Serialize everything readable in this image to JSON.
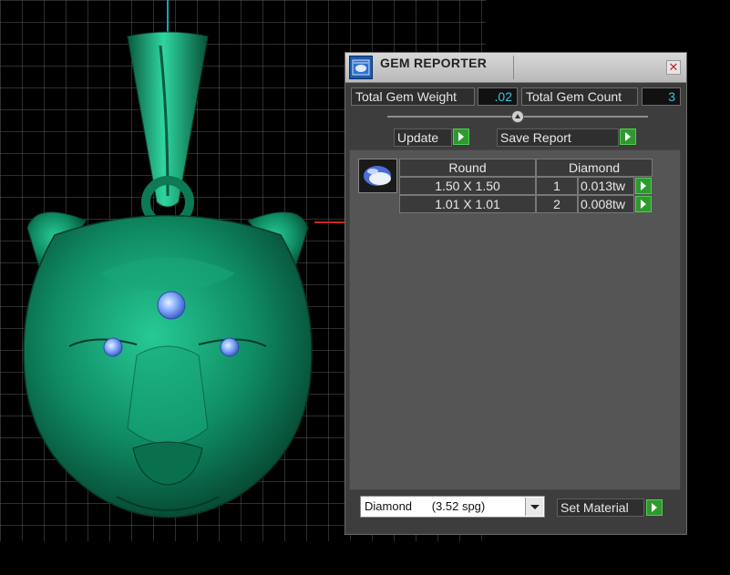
{
  "window": {
    "title": "GEM REPORTER",
    "close_glyph": "✕"
  },
  "summary": {
    "weight_label": "Total Gem Weight",
    "weight_value": ".02",
    "count_label": "Total Gem Count",
    "count_value": "3"
  },
  "slider": {
    "value_fraction": 0.5
  },
  "actions": {
    "update_label": "Update",
    "save_label": "Save Report"
  },
  "report": {
    "gem_icon": "gem-thumbnail-icon",
    "header": {
      "shape": "Round",
      "material": "Diamond"
    },
    "rows": [
      {
        "size": "1.50 X 1.50",
        "count": "1",
        "weight": "0.013tw"
      },
      {
        "size": "1.01 X 1.01",
        "count": "2",
        "weight": "0.008tw"
      }
    ]
  },
  "material": {
    "selected": "Diamond      (3.52 spg)",
    "set_label": "Set Material"
  },
  "colors": {
    "model": "#0f8a63",
    "grid": "#555555",
    "value_text": "#33c6e6",
    "play_button": "#2e9a2e",
    "gem": "#7aa7ff"
  }
}
